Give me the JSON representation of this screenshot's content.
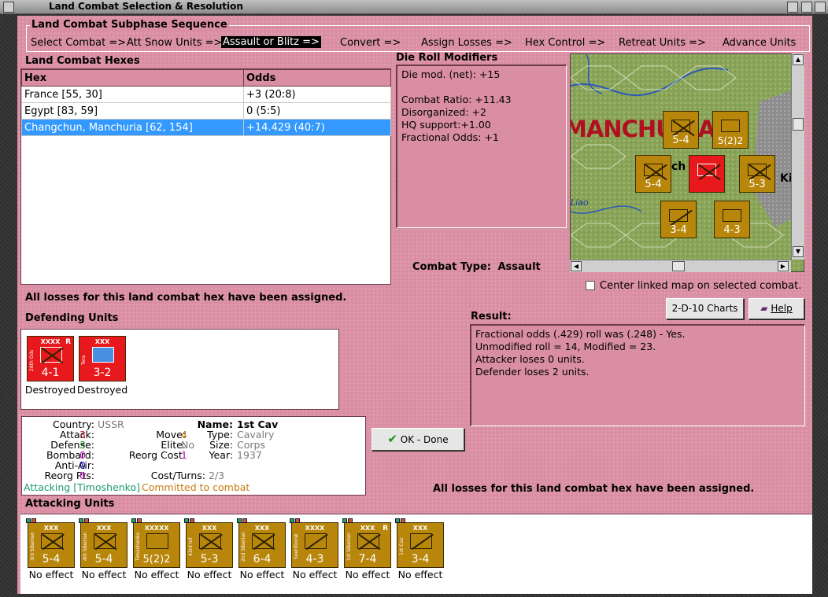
{
  "window": {
    "title": "Land Combat Selection & Resolution"
  },
  "sequence": {
    "legend": "Land Combat Subphase Sequence",
    "steps": [
      "Select Combat =>",
      "Att Snow Units =>",
      "Assault or Blitz =>",
      "Convert =>",
      "Assign Losses =>",
      "Hex Control =>",
      "Retreat Units =>",
      "Advance Units"
    ]
  },
  "hexes": {
    "title": "Land Combat Hexes",
    "col_hex": "Hex",
    "col_odds": "Odds",
    "rows": [
      {
        "hex": "France [55, 30]",
        "odds": "+3 (20:8)"
      },
      {
        "hex": "Egypt [83, 59]",
        "odds": "0 (5:5)"
      },
      {
        "hex": "Changchun, Manchuria [62, 154]",
        "odds": "+14.429 (40:7)"
      }
    ]
  },
  "modifiers": {
    "title": "Die Roll Modifiers",
    "net": "Die mod. (net): +15",
    "ratio": "Combat Ratio: +11.43",
    "disorg": "Disorganized: +2",
    "hq": "HQ support:+1.00",
    "frac": "Fractional Odds: +1"
  },
  "combat_type": {
    "label": "Combat Type:",
    "value": "Assault"
  },
  "map": {
    "place_label": "MANCHURIA",
    "river_label": "Liao",
    "city_label": "Ki",
    "ch_label": "ch"
  },
  "center_map": {
    "label": "Center linked map on selected combat."
  },
  "buttons": {
    "charts": "2-D-10 Charts",
    "help": "Help",
    "ok": "OK - Done"
  },
  "losses_msg": "All losses for this land combat hex have been assigned.",
  "defending": {
    "title": "Defending Units",
    "units": [
      {
        "size": "XXXX",
        "side": "28th Gds",
        "strength": "4-1",
        "mark": "R",
        "status": "Destroyed"
      },
      {
        "size": "XXX",
        "side": "Tera",
        "strength": "3-2",
        "mark": "",
        "status": "Destroyed"
      }
    ]
  },
  "result": {
    "title": "Result:",
    "lines": [
      "Fractional odds (.429) roll was (.248)  - Yes.",
      "Unmodified roll = 14, Modified = 23.",
      "Attacker loses 0 units.",
      "Defender loses 2 units."
    ]
  },
  "unit_stats": {
    "country_l": "Country:",
    "country": "USSR",
    "attack_l": "Attack:",
    "attack": "3",
    "defense_l": "Defense:",
    "defense": "3",
    "bombard_l": "Bombard:",
    "bombard": "0",
    "antiair_l": "Anti-Air:",
    "antiair": "0",
    "reorgpts_l": "Reorg Pts:",
    "reorgpts": "0",
    "name_l": "Name:",
    "name": "1st Cav",
    "move_l": "Move:",
    "move": "4",
    "type_l": "Type:",
    "type": "Cavalry",
    "elite_l": "Elite:",
    "elite": "No",
    "size_l": "Size:",
    "size": "Corps",
    "reorgcost_l": "Reorg Cost:",
    "reorgcost": "1",
    "year_l": "Year:",
    "year": "1937",
    "costturns_l": "Cost/Turns:",
    "costturns": "2/3",
    "attacking_note": "Attacking [Timoshenko]",
    "committed_note": "Committed to combat"
  },
  "attacking": {
    "title": "Attacking Units",
    "units": [
      {
        "size": "XXX",
        "side": "3rd Siberian",
        "strength": "5-4",
        "type": "inf",
        "mark": "",
        "status": "No effect"
      },
      {
        "size": "XXX",
        "side": "4th Siberian",
        "strength": "5-4",
        "type": "inf",
        "mark": "",
        "status": "No effect"
      },
      {
        "size": "XXXXX",
        "side": "Timoshenko",
        "strength": "5(2)2",
        "type": "hq",
        "mark": "",
        "status": "No effect"
      },
      {
        "size": "XXX",
        "side": "43rd Inf",
        "strength": "5-3",
        "type": "inf2",
        "mark": "",
        "status": "No effect"
      },
      {
        "size": "XXX",
        "side": "2nd Siberian",
        "strength": "6-4",
        "type": "inf",
        "mark": "",
        "status": "No effect"
      },
      {
        "size": "XXXX",
        "side": "Sverdlovsk",
        "strength": "4-3",
        "type": "mtn",
        "mark": "",
        "status": "No effect"
      },
      {
        "size": "XXX",
        "side": "1st Siberian",
        "strength": "7-4",
        "type": "inf",
        "mark": "R",
        "status": "No effect"
      },
      {
        "size": "XXX",
        "side": "1st Cav",
        "strength": "3-4",
        "type": "cav",
        "mark": "",
        "status": "No effect"
      }
    ]
  }
}
